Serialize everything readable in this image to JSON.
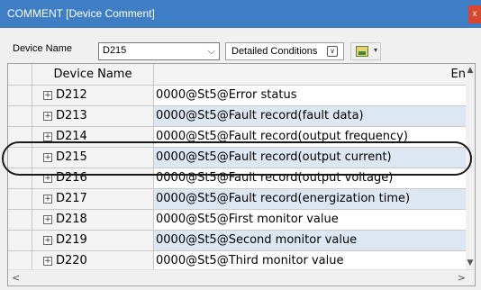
{
  "window": {
    "title": "COMMENT [Device Comment]",
    "close_label": "x"
  },
  "toolbar": {
    "device_name_label": "Device Name",
    "device_name_value": "D215",
    "detail_button_label": "Detailed Conditions"
  },
  "grid": {
    "columns": [
      "Device Name",
      "En"
    ],
    "rows": [
      {
        "device": "D212",
        "comment": "0000@St5@Error status"
      },
      {
        "device": "D213",
        "comment": "0000@St5@Fault record(fault data)"
      },
      {
        "device": "D214",
        "comment": "0000@St5@Fault record(output frequency)"
      },
      {
        "device": "D215",
        "comment": "0000@St5@Fault record(output current)"
      },
      {
        "device": "D216",
        "comment": "0000@St5@Fault record(output voltage)"
      },
      {
        "device": "D217",
        "comment": "0000@St5@Fault record(energization time)"
      },
      {
        "device": "D218",
        "comment": "0000@St5@First monitor value"
      },
      {
        "device": "D219",
        "comment": "0000@St5@Second monitor value"
      },
      {
        "device": "D220",
        "comment": "0000@St5@Third monitor value"
      }
    ]
  },
  "icons": {
    "expand": "plus-box-icon",
    "combo_caret": "chevron-down-icon",
    "detail_toggle": "double-chevron-icon",
    "grid_view": "grid-view-icon"
  },
  "colors": {
    "title_bar": "#3d7ec5",
    "row_alternate": "#dde7f2",
    "highlight_ring": "#1a1a1a"
  }
}
